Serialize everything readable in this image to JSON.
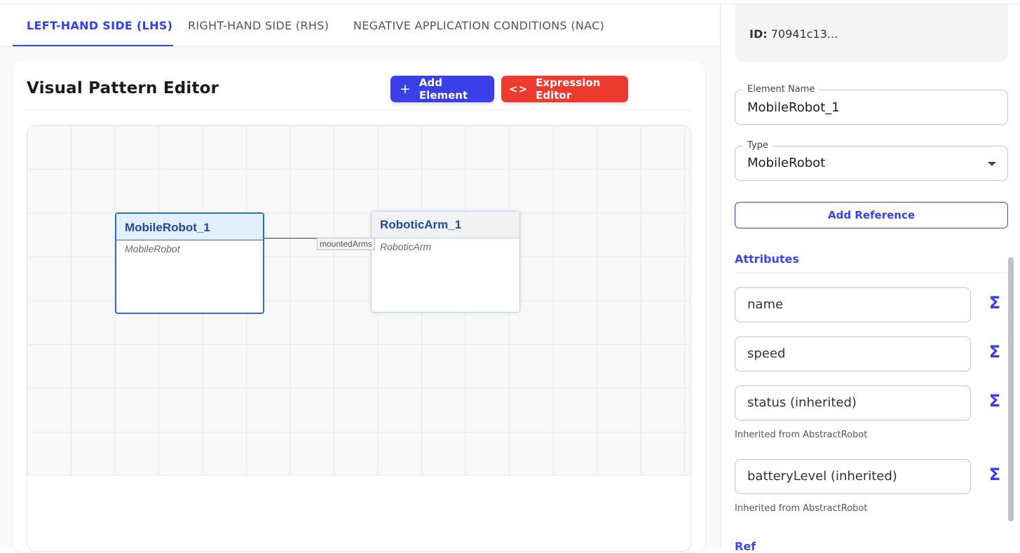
{
  "tabs": [
    {
      "label": "LEFT-HAND SIDE (LHS)",
      "active": true
    },
    {
      "label": "RIGHT-HAND SIDE (RHS)",
      "active": false
    },
    {
      "label": "NEGATIVE APPLICATION CONDITIONS (NAC)",
      "active": false
    }
  ],
  "editor": {
    "title": "Visual Pattern Editor",
    "add_element_label": "Add Element",
    "expression_editor_label": "Expression Editor",
    "add_icon": "plus-icon",
    "code_icon": "code-brackets-icon",
    "nodes": [
      {
        "name": "MobileRobot_1",
        "type": "MobileRobot",
        "selected": true
      },
      {
        "name": "RoboticArm_1",
        "type": "RoboticArm",
        "selected": false
      }
    ],
    "edge_label": "mountedArms"
  },
  "side": {
    "id_label": "ID:",
    "id_value": "70941c13...",
    "element_name_legend": "Element Name",
    "element_name_value": "MobileRobot_1",
    "type_legend": "Type",
    "type_value": "MobileRobot",
    "add_reference_label": "Add Reference",
    "attributes_title": "Attributes",
    "attributes": [
      {
        "label": "name",
        "helper": ""
      },
      {
        "label": "speed",
        "helper": ""
      },
      {
        "label": "status (inherited)",
        "helper": "Inherited from AbstractRobot"
      },
      {
        "label": "batteryLevel (inherited)",
        "helper": "Inherited from AbstractRobot"
      }
    ],
    "sigma_icon": "sigma-icon",
    "next_section_partial": "Ref"
  },
  "colors": {
    "accent": "#3a3fe8",
    "danger": "#ee3b2f",
    "node_border": "#2c6fc8",
    "node_title": "#1e4aa0"
  }
}
